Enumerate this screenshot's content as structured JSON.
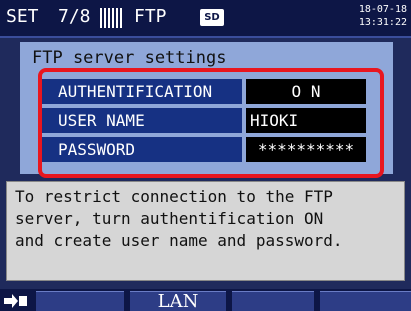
{
  "topbar": {
    "mode": "SET",
    "page": "7/8",
    "section": "FTP",
    "sd_badge": "SD",
    "date": "18-07-18",
    "time": "13:31:22"
  },
  "panel": {
    "title": "FTP server settings",
    "rows": [
      {
        "label": "AUTHENTIFICATION",
        "value": "O N"
      },
      {
        "label": "USER NAME",
        "value": "HIOKI"
      },
      {
        "label": "PASSWORD",
        "value": "**********"
      }
    ]
  },
  "message": "To restrict connection to the FTP\nserver, turn authentification ON\nand create user name and password.",
  "softkeys": [
    "",
    "LAN",
    "",
    ""
  ],
  "colors": {
    "highlight": "#e8161f",
    "panel": "#8fa7d9",
    "label_bg": "#163183"
  },
  "icons": {
    "side": "plug-arrow-icon",
    "stripes": "memory-bars-icon"
  }
}
